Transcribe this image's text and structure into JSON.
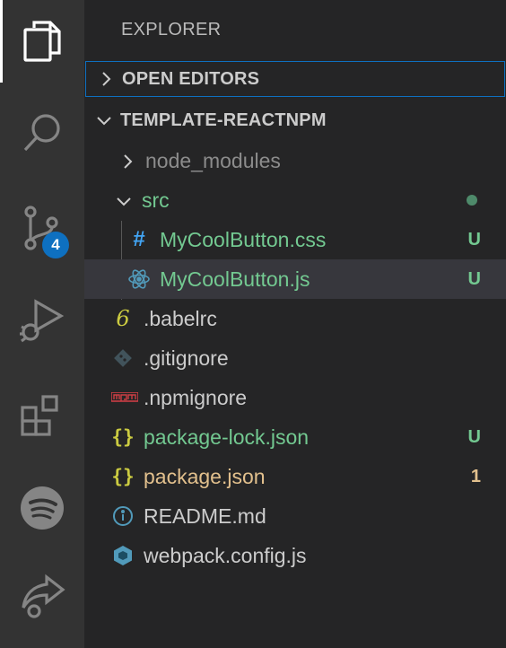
{
  "activity_bar": {
    "items": [
      {
        "icon": "explorer-icon",
        "active": true
      },
      {
        "icon": "search-icon"
      },
      {
        "icon": "source-control-icon",
        "badge": "4"
      },
      {
        "icon": "run-debug-icon"
      },
      {
        "icon": "extensions-icon"
      },
      {
        "icon": "spotify-icon"
      },
      {
        "icon": "live-share-icon"
      }
    ]
  },
  "explorer": {
    "title": "EXPLORER",
    "open_editors_label": "OPEN EDITORS",
    "project_label": "TEMPLATE-REACTNPM",
    "tree": [
      {
        "name": "node_modules",
        "kind": "folder-collapsed",
        "color": "#8c8c8c"
      },
      {
        "name": "src",
        "kind": "folder-open",
        "color": "#73c991",
        "status": "dot"
      },
      {
        "name": "MyCoolButton.css",
        "kind": "file",
        "icon": "css-hash-icon",
        "color": "#73c991",
        "status": "U"
      },
      {
        "name": "MyCoolButton.js",
        "kind": "file",
        "icon": "react-icon",
        "color": "#73c991",
        "status": "U",
        "selected": true
      },
      {
        "name": ".babelrc",
        "kind": "file",
        "icon": "babel-icon",
        "color": "#cccccc"
      },
      {
        "name": ".gitignore",
        "kind": "file",
        "icon": "git-icon",
        "color": "#cccccc"
      },
      {
        "name": ".npmignore",
        "kind": "file",
        "icon": "npm-icon",
        "color": "#cccccc"
      },
      {
        "name": "package-lock.json",
        "kind": "file",
        "icon": "json-icon",
        "color": "#73c991",
        "status": "U"
      },
      {
        "name": "package.json",
        "kind": "file",
        "icon": "json-icon",
        "color": "#e2c08d",
        "status": "1"
      },
      {
        "name": "README.md",
        "kind": "file",
        "icon": "info-icon",
        "color": "#cccccc"
      },
      {
        "name": "webpack.config.js",
        "kind": "file",
        "icon": "webpack-icon",
        "color": "#cccccc"
      }
    ]
  },
  "colors": {
    "untracked": "#73c991",
    "modified": "#e2c08d",
    "accent": "#0e70c0"
  }
}
